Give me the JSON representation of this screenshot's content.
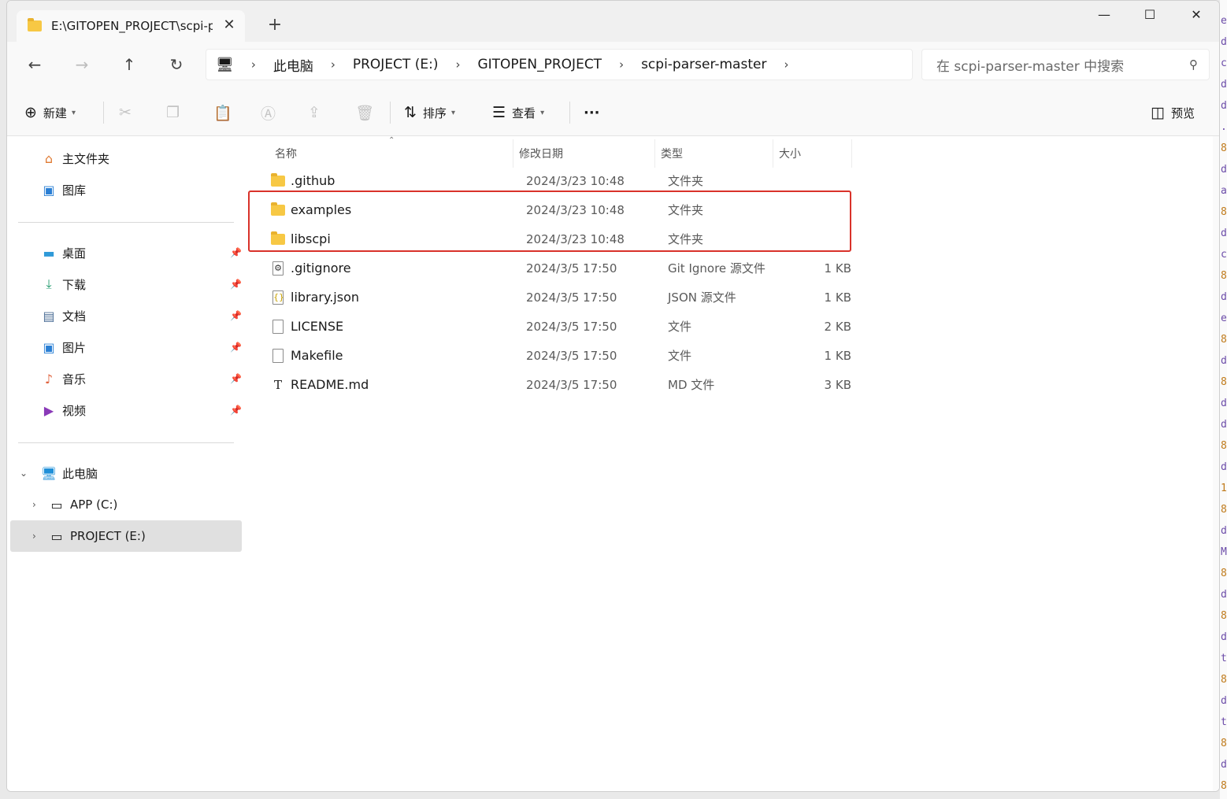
{
  "tab": {
    "title": "E:\\GITOPEN_PROJECT\\scpi-par",
    "close": "✕",
    "new": "+"
  },
  "window_controls": {
    "minimize": "—",
    "maximize": "☐",
    "close": "✕"
  },
  "nav": {
    "back": "←",
    "forward": "→",
    "up": "↑",
    "refresh": "↻"
  },
  "address": {
    "crumbs": [
      "此电脑",
      "PROJECT (E:)",
      "GITOPEN_PROJECT",
      "scpi-parser-master"
    ],
    "separator": "›"
  },
  "search": {
    "placeholder": "在 scpi-parser-master 中搜索"
  },
  "toolbar": {
    "new_label": "新建",
    "sort_label": "排序",
    "view_label": "查看",
    "more_label": "···",
    "preview_label": "预览"
  },
  "sidebar": {
    "quick": [
      {
        "label": "主文件夹",
        "icon": "home-icon"
      },
      {
        "label": "图库",
        "icon": "gallery-icon"
      }
    ],
    "pinned": [
      {
        "label": "桌面",
        "icon": "desktop-icon"
      },
      {
        "label": "下载",
        "icon": "download-icon"
      },
      {
        "label": "文档",
        "icon": "documents-icon"
      },
      {
        "label": "图片",
        "icon": "pictures-icon"
      },
      {
        "label": "音乐",
        "icon": "music-icon"
      },
      {
        "label": "视频",
        "icon": "videos-icon"
      }
    ],
    "this_pc": {
      "label": "此电脑",
      "icon": "computer-icon"
    },
    "drives": [
      {
        "label": "APP (C:)",
        "icon": "drive-icon"
      },
      {
        "label": "PROJECT (E:)",
        "icon": "drive-icon",
        "selected": true
      }
    ]
  },
  "columns": {
    "name": "名称",
    "date": "修改日期",
    "type": "类型",
    "size": "大小"
  },
  "files": [
    {
      "name": ".github",
      "date": "2024/3/23 10:48",
      "type": "文件夹",
      "size": "",
      "icon": "folder-icon"
    },
    {
      "name": "examples",
      "date": "2024/3/23 10:48",
      "type": "文件夹",
      "size": "",
      "icon": "folder-icon"
    },
    {
      "name": "libscpi",
      "date": "2024/3/23 10:48",
      "type": "文件夹",
      "size": "",
      "icon": "folder-icon"
    },
    {
      "name": ".gitignore",
      "date": "2024/3/5 17:50",
      "type": "Git Ignore 源文件",
      "size": "1 KB",
      "icon": "settings-file-icon"
    },
    {
      "name": "library.json",
      "date": "2024/3/5 17:50",
      "type": "JSON 源文件",
      "size": "1 KB",
      "icon": "json-file-icon"
    },
    {
      "name": "LICENSE",
      "date": "2024/3/5 17:50",
      "type": "文件",
      "size": "2 KB",
      "icon": "file-icon"
    },
    {
      "name": "Makefile",
      "date": "2024/3/5 17:50",
      "type": "文件",
      "size": "1 KB",
      "icon": "file-icon"
    },
    {
      "name": "README.md",
      "date": "2024/3/5 17:50",
      "type": "MD 文件",
      "size": "3 KB",
      "icon": "text-file-icon"
    }
  ],
  "right_strip": [
    "e",
    "d",
    "c",
    "d",
    "d",
    ".",
    "8",
    "d",
    "a",
    "8",
    "d",
    "c",
    "8",
    "d",
    "e",
    "8",
    "d",
    "8",
    "d",
    "d",
    "8",
    "d",
    "1",
    "8",
    "d",
    "M",
    "8",
    "d",
    "8",
    "d",
    "t",
    "8",
    "d",
    "t",
    "8",
    "d",
    "8"
  ],
  "colors": {
    "highlight": "#d9322a",
    "folder": "#f7c844",
    "selected": "#e0e0e0"
  }
}
